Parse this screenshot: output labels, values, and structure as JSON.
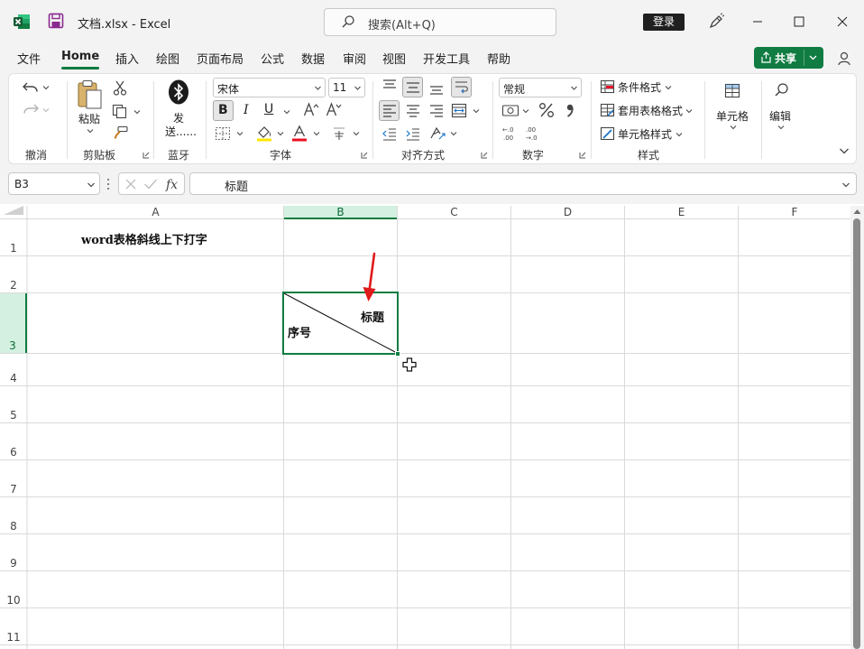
{
  "window": {
    "doc_title": "文档.xlsx  -  Excel",
    "search_placeholder": "搜索(Alt+Q)",
    "login_label": "登录"
  },
  "tabs": [
    {
      "label": "文件"
    },
    {
      "label": "Home"
    },
    {
      "label": "插入"
    },
    {
      "label": "绘图"
    },
    {
      "label": "页面布局"
    },
    {
      "label": "公式"
    },
    {
      "label": "数据"
    },
    {
      "label": "审阅"
    },
    {
      "label": "视图"
    },
    {
      "label": "开发工具"
    },
    {
      "label": "帮助"
    }
  ],
  "share_label": "共享",
  "ribbon": {
    "groups": {
      "undo": "撤消",
      "clipboard": "剪贴板",
      "bluetooth": "蓝牙",
      "font": "字体",
      "alignment": "对齐方式",
      "number": "数字",
      "styles": "样式"
    },
    "paste_label": "粘贴",
    "send_label_1": "发",
    "send_label_2": "送......",
    "font_name": "宋体",
    "font_size": "11",
    "bold": "B",
    "italic": "I",
    "underline": "U",
    "number_format": "常规",
    "conditional_format": "条件格式",
    "table_format": "套用表格格式",
    "cell_style": "单元格样式",
    "cells_label": "单元格",
    "editing_label": "编辑"
  },
  "formula_bar": {
    "name_box": "B3",
    "formula": "标题"
  },
  "sheet": {
    "columns": [
      "A",
      "B",
      "C",
      "D",
      "E",
      "F"
    ],
    "rows": [
      "1",
      "2",
      "3",
      "4",
      "5",
      "6",
      "7",
      "8",
      "9",
      "10",
      "11"
    ],
    "a1_text": "word表格斜线上下打字",
    "b3_top_right": "标题",
    "b3_bottom_left": "序号",
    "selected_cell": "B3"
  },
  "colors": {
    "accent_green": "#107c41",
    "annotation_red": "#e0191b"
  }
}
